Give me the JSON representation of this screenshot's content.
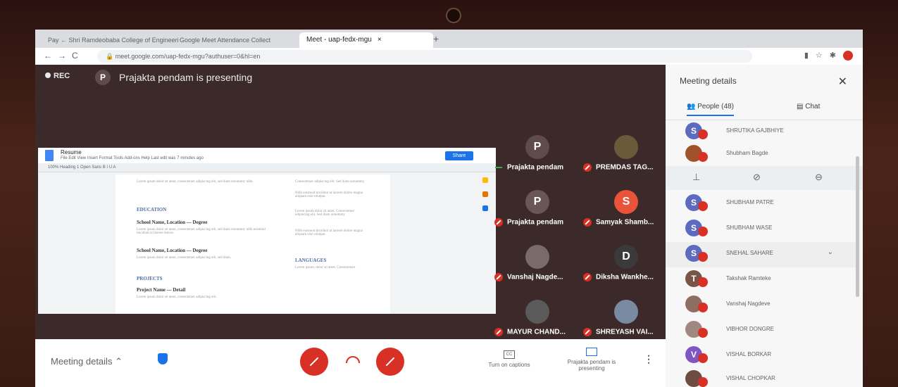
{
  "browser": {
    "tabs": [
      {
        "label": "Pay ← Shri Ramdeobaba College of Engineering"
      },
      {
        "label": "Google Meet Attendance Collect"
      },
      {
        "label": "Meet - uap-fedx-mgu"
      }
    ],
    "url": "meet.google.com/uap-fedx-mgu?authuser=0&hl=en"
  },
  "meet": {
    "rec_label": "REC",
    "presenter_initial": "P",
    "presenting_text": "Prajakta pendam is presenting"
  },
  "doc": {
    "title": "Resume",
    "menu": "File  Edit  View  Insert  Format  Tools  Add-ons  Help   Last edit was 7 minutes ago",
    "share_label": "Share",
    "toolbar": "100%   Heading 1   Open Sans   B  I  U  A",
    "lines": {
      "lorem1": "Lorem ipsum dolor sit amet, consectetuer adipiscing elit, sed diam nonummy nibh.",
      "education": "EDUCATION",
      "school1": "School Name, Location — Degree",
      "lorem2": "Lorem ipsum dolor sit amet, consectetuer adipiscing elit, sed diam nonummy nibh euismod tincidunt ut laoreet dolore.",
      "school2": "School Name, Location — Degree",
      "lorem3": "Lorem ipsum dolor sit amet, consectetuer adipiscing elit, sed diam.",
      "projects": "PROJECTS",
      "project": "Project Name — Detail",
      "lorem4": "Lorem ipsum dolor sit amet, consectetuer adipiscing elit.",
      "right1": "Consectetuer adipiscing elit. Sed diam nonummy",
      "right2": "Nibh euismod tincidunt ut laoreet dolore magna aliquam erat volutpat.",
      "right3": "Lorem ipsum dolor sit amet. Consectetuer adipiscing elit. Sed diam nonummy",
      "right4": "Nibh euismod tincidunt ut laoreet dolore magna aliquam erat volutpat.",
      "languages": "LANGUAGES",
      "right5": "Lorem ipsum, dolor sit amet. Consectetuer"
    }
  },
  "tiles": [
    {
      "initial": "P",
      "name": "Prajakta pendam",
      "color": "#5f4b4b",
      "mic": "on"
    },
    {
      "initial": "",
      "name": "PREMDAS TAG...",
      "color": "#6b5a3a",
      "mic": "off"
    },
    {
      "initial": "P",
      "name": "Prajakta pendam",
      "color": "#6a5656",
      "mic": "off"
    },
    {
      "initial": "S",
      "name": "Samyak Shamb...",
      "color": "#e8533a",
      "mic": "off"
    },
    {
      "initial": "",
      "name": "Vanshaj Nagde...",
      "color": "#7a6a6a",
      "mic": "off"
    },
    {
      "initial": "D",
      "name": "Diksha Wankhe...",
      "color": "#3a3a3a",
      "mic": "off"
    },
    {
      "initial": "",
      "name": "MAYUR CHAND...",
      "color": "#5a5a5a",
      "mic": "off"
    },
    {
      "initial": "",
      "name": "SHREYASH VAI...",
      "color": "#7a8aa0",
      "mic": "off"
    }
  ],
  "bottom": {
    "meeting_details": "Meeting details",
    "captions": "Turn on captions",
    "presenting": "Prajakta pendam is presenting"
  },
  "panel": {
    "title": "Meeting details",
    "people_tab": "People (48)",
    "chat_tab": "Chat",
    "people": [
      {
        "initial": "S",
        "name": "SHRUTIKA GAJBHIYE",
        "color": "#5c6bc0"
      },
      {
        "initial": "",
        "name": "Shubham Bagde",
        "color": "#a0522d"
      },
      {
        "initial": "S",
        "name": "SHUBHAM PATRE",
        "color": "#5c6bc0"
      },
      {
        "initial": "S",
        "name": "SHUBHAM WASE",
        "color": "#5c6bc0"
      },
      {
        "initial": "S",
        "name": "SNEHAL SAHARE",
        "color": "#5c6bc0"
      },
      {
        "initial": "T",
        "name": "Takshak Ramteke",
        "color": "#795548"
      },
      {
        "initial": "",
        "name": "Vanshaj Nagdeve",
        "color": "#8d6e63"
      },
      {
        "initial": "",
        "name": "VIBHOR DONGRE",
        "color": "#a1887f"
      },
      {
        "initial": "V",
        "name": "VISHAL BORKAR",
        "color": "#7e57c2"
      },
      {
        "initial": "",
        "name": "VISHAL CHOPKAR",
        "color": "#6d4c41"
      }
    ]
  }
}
